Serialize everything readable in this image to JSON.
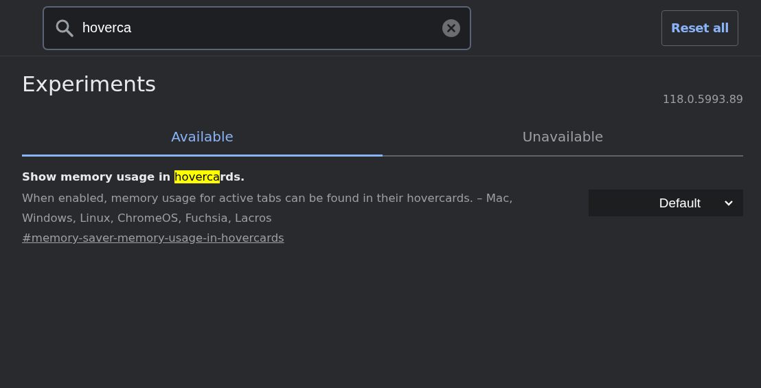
{
  "search": {
    "value": "hoverca"
  },
  "reset_button": "Reset all",
  "title": "Experiments",
  "version": "118.0.5993.89",
  "tabs": [
    {
      "label": "Available",
      "selected": true
    },
    {
      "label": "Unavailable",
      "selected": false
    }
  ],
  "experiments": [
    {
      "title_before": "Show memory usage in ",
      "title_match": "hoverca",
      "title_after": "rds.",
      "description": "When enabled, memory usage for active tabs can be found in their hovercards. – Mac, Windows, Linux, ChromeOS, Fuchsia, Lacros",
      "link": "#memory-saver-memory-usage-in-hovercards",
      "value": "Default"
    }
  ]
}
